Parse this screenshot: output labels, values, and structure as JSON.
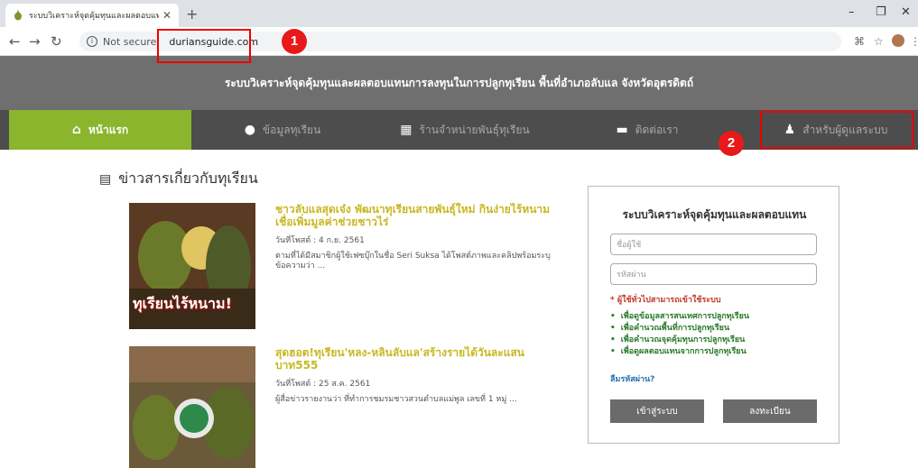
{
  "browser": {
    "tab_title": "ระบบวิเคราะห์จุดคุ้มทุนและผลตอบแทน",
    "tab_close": "✕",
    "new_tab": "+",
    "not_secure": "Not secure",
    "url": "duriansguide.com",
    "window_controls": [
      "–",
      "❐",
      "✕"
    ]
  },
  "annotations": {
    "badge1": "1",
    "badge2": "2"
  },
  "site": {
    "header_title": "ระบบวิเคราะห์จุดคุ้มทุนและผลตอบแทนการลงทุนในการปลูกทุเรียน พื้นที่อำเภอลับแล จังหวัดอุตรดิตถ์",
    "nav": [
      {
        "label": "หน้าแรก",
        "icon": "home-icon"
      },
      {
        "label": "ข้อมูลทุเรียน",
        "icon": "durian-icon"
      },
      {
        "label": "ร้านจำหน่ายพันธุ์ทุเรียน",
        "icon": "shop-icon"
      },
      {
        "label": "ติดต่อเรา",
        "icon": "chat-icon"
      },
      {
        "label": "สำหรับผู้ดูแลระบบ",
        "icon": "admin-icon"
      }
    ]
  },
  "news": {
    "heading": "ข่าวสารเกี่ยวกับทุเรียน",
    "items": [
      {
        "title": "ชาวลับแลสุดเจ๋ง พัฒนาทุเรียนสายพันธุ์ใหม่ กินง่ายไร้หนาม เชื่อเพิ่มมูลค่าช่วยชาวไร่",
        "date": "วันที่โพสต์ : 4 ก.ย. 2561",
        "excerpt": "ตามที่ได้มีสมาชิกผู้ใช้เฟซบุ๊กในชื่อ Seri Suksa ได้โพสต์ภาพและคลิปพร้อมระบุข้อความว่า ...",
        "thumb_text": "ทุเรียนไร้หนาม!"
      },
      {
        "title": "สุดฮอต!ทุเรียน'หลง-หลินลับแล'สร้างรายได้วันละแสนบาท555",
        "date": "วันที่โพสต์ : 25 ส.ค. 2561",
        "excerpt": "ผู้สื่อข่าวรายงานว่า ที่ทำการชมรมชาวสวนตำบลแม่พูล เลขที่ 1 หมู่ ..."
      }
    ]
  },
  "login": {
    "title": "ระบบวิเคราะห์จุดคุ้มทุนและผลตอบแทน",
    "username_placeholder": "ชื่อผู้ใช้",
    "password_placeholder": "รหัสผ่าน",
    "note": "* ผู้ใช้ทั่วไปสามารถเข้าใช้ระบบ",
    "features": [
      "เพื่อดูข้อมูลสารสนเทศการปลูกทุเรียน",
      "เพื่อคำนวณพื้นที่การปลูกทุเรียน",
      "เพื่อคำนวณจุดคุ้มทุนการปลูกทุเรียน",
      "เพื่อดูผลตอบแทนจากการปลูกทุเรียน"
    ],
    "forgot": "ลืมรหัสผ่าน?",
    "login_button": "เข้าสู่ระบบ",
    "register_button": "ลงทะเบียน"
  },
  "colors": {
    "accent_green": "#8ab52c",
    "header_gray": "#6f6f6f",
    "nav_dark": "#4d4d4d",
    "annotation_red": "#e8191a"
  }
}
